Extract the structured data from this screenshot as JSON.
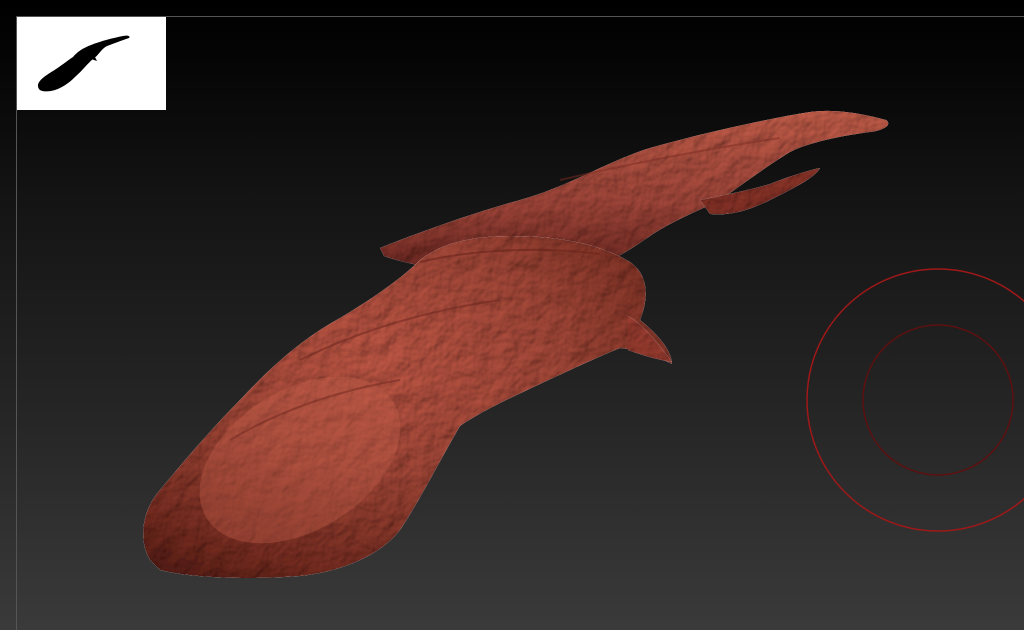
{
  "app": {
    "viewport_background": "#1a1a1a",
    "frame_color": "#555555",
    "model_color": "#a8463a",
    "cursor_color": "#b01818"
  },
  "viewport": {
    "thumbnail": {
      "background": "#ffffff",
      "silhouette_color": "#000000",
      "icon": "model-silhouette-icon"
    },
    "model": {
      "icon": "sculpt-mesh"
    },
    "brush_cursor": {
      "icon": "brush-draw-size-ring-icon"
    }
  }
}
